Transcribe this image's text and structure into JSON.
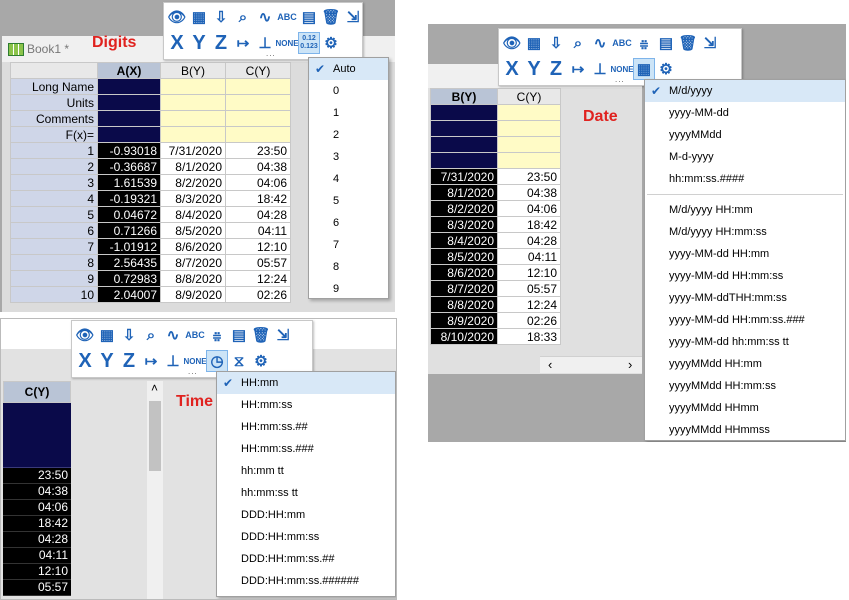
{
  "labels": {
    "digits": "Digits",
    "date": "Date",
    "time": "Time"
  },
  "book_title": "Book1 *",
  "digits_panel": {
    "headers": {
      "rownames": "",
      "a": "A(X)",
      "b": "B(Y)",
      "c": "C(Y)"
    },
    "meta_rows": [
      "Long Name",
      "Units",
      "Comments",
      "F(x)="
    ],
    "rows": [
      {
        "n": "1",
        "a": "-0.93018",
        "b": "7/31/2020",
        "c": "23:50"
      },
      {
        "n": "2",
        "a": "-0.36687",
        "b": "8/1/2020",
        "c": "04:38"
      },
      {
        "n": "3",
        "a": "1.61539",
        "b": "8/2/2020",
        "c": "04:06"
      },
      {
        "n": "4",
        "a": "-0.19321",
        "b": "8/3/2020",
        "c": "18:42"
      },
      {
        "n": "5",
        "a": "0.04672",
        "b": "8/4/2020",
        "c": "04:28"
      },
      {
        "n": "6",
        "a": "0.71266",
        "b": "8/5/2020",
        "c": "04:11"
      },
      {
        "n": "7",
        "a": "-1.01912",
        "b": "8/6/2020",
        "c": "12:10"
      },
      {
        "n": "8",
        "a": "2.56435",
        "b": "8/7/2020",
        "c": "05:57"
      },
      {
        "n": "9",
        "a": "0.72983",
        "b": "8/8/2020",
        "c": "12:24"
      },
      {
        "n": "10",
        "a": "2.04007",
        "b": "8/9/2020",
        "c": "02:26"
      }
    ],
    "menu": [
      "Auto",
      "0",
      "1",
      "2",
      "3",
      "4",
      "5",
      "6",
      "7",
      "8",
      "9"
    ],
    "selected": "Auto",
    "digits_icon_text": [
      "0.12",
      "0.123"
    ]
  },
  "date_panel": {
    "headers": {
      "b": "B(Y)",
      "c": "C(Y)"
    },
    "rows": [
      {
        "b": "7/31/2020",
        "c": "23:50"
      },
      {
        "b": "8/1/2020",
        "c": "04:38"
      },
      {
        "b": "8/2/2020",
        "c": "04:06"
      },
      {
        "b": "8/3/2020",
        "c": "18:42"
      },
      {
        "b": "8/4/2020",
        "c": "04:28"
      },
      {
        "b": "8/5/2020",
        "c": "04:11"
      },
      {
        "b": "8/6/2020",
        "c": "12:10"
      },
      {
        "b": "8/7/2020",
        "c": "05:57"
      },
      {
        "b": "8/8/2020",
        "c": "12:24"
      },
      {
        "b": "8/9/2020",
        "c": "02:26"
      },
      {
        "b": "8/10/2020",
        "c": "18:33"
      }
    ],
    "menu_group1": [
      "M/d/yyyy",
      "yyyy-MM-dd",
      "yyyyMMdd",
      "M-d-yyyy",
      "hh:mm:ss.####"
    ],
    "menu_group2": [
      "M/d/yyyy HH:mm",
      "M/d/yyyy HH:mm:ss",
      "yyyy-MM-dd HH:mm",
      "yyyy-MM-dd HH:mm:ss",
      "yyyy-MM-ddTHH:mm:ss",
      "yyyy-MM-dd HH:mm:ss.###",
      "yyyy-MM-dd hh:mm:ss tt",
      "yyyyMMdd HH:mm",
      "yyyyMMdd HH:mm:ss",
      "yyyyMMdd HHmm",
      "yyyyMMdd HHmmss"
    ],
    "selected": "M/d/yyyy"
  },
  "time_panel": {
    "header": "C(Y)",
    "rows": [
      "23:50",
      "04:38",
      "04:06",
      "18:42",
      "04:28",
      "04:11",
      "12:10",
      "05:57"
    ],
    "menu": [
      "HH:mm",
      "HH:mm:ss",
      "HH:mm:ss.##",
      "HH:mm:ss.###",
      "hh:mm tt",
      "hh:mm:ss tt",
      "DDD:HH:mm",
      "DDD:HH:mm:ss",
      "DDD:HH:mm:ss.##",
      "DDD:HH:mm:ss.######"
    ],
    "selected": "HH:mm"
  },
  "toolbar": {
    "x_label": "X",
    "y_label": "Y",
    "z_label": "Z",
    "none_label": "NONE",
    "icons_row1": [
      "show-hide-icon",
      "column-icon",
      "sort-icon",
      "find-icon",
      "signal-icon",
      "abc-icon",
      "distribution-icon",
      "table-image-icon",
      "clear-icon",
      "export-icon"
    ]
  },
  "scroll": {
    "left_arrow": "‹",
    "right_arrow": "›",
    "up_arrow": "˄"
  }
}
